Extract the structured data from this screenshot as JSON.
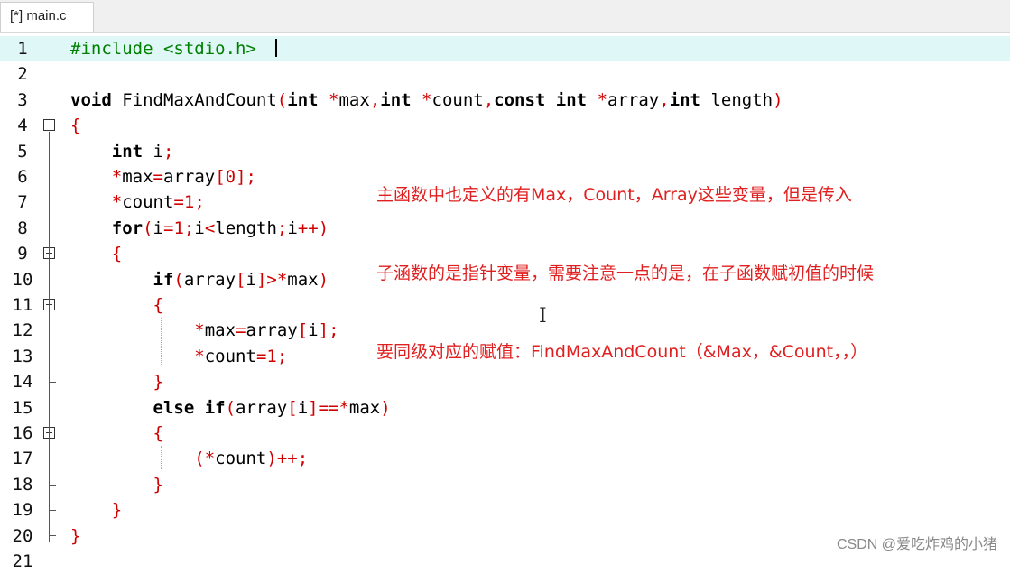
{
  "tab": {
    "title": "[*] main.c"
  },
  "lines": [
    {
      "n": "1",
      "segs": [
        [
          "pp",
          "#include <stdio.h>"
        ]
      ]
    },
    {
      "n": "2",
      "segs": []
    },
    {
      "n": "3",
      "segs": [
        [
          "kw",
          "void"
        ],
        [
          "t",
          " FindMaxAndCount"
        ],
        [
          "op",
          "("
        ],
        [
          "kw",
          "int"
        ],
        [
          "t",
          " "
        ],
        [
          "op",
          "*"
        ],
        [
          "t",
          "max"
        ],
        [
          "op",
          ","
        ],
        [
          "kw",
          "int"
        ],
        [
          "t",
          " "
        ],
        [
          "op",
          "*"
        ],
        [
          "t",
          "count"
        ],
        [
          "op",
          ","
        ],
        [
          "kw",
          "const int"
        ],
        [
          "t",
          " "
        ],
        [
          "op",
          "*"
        ],
        [
          "t",
          "array"
        ],
        [
          "op",
          ","
        ],
        [
          "kw",
          "int"
        ],
        [
          "t",
          " length"
        ],
        [
          "op",
          ")"
        ]
      ]
    },
    {
      "n": "4",
      "segs": [
        [
          "brace",
          "{"
        ]
      ]
    },
    {
      "n": "5",
      "segs": [
        [
          "t",
          "    "
        ],
        [
          "kw",
          "int"
        ],
        [
          "t",
          " i"
        ],
        [
          "op",
          ";"
        ]
      ]
    },
    {
      "n": "6",
      "segs": [
        [
          "t",
          "    "
        ],
        [
          "op",
          "*"
        ],
        [
          "t",
          "max"
        ],
        [
          "op",
          "="
        ],
        [
          "t",
          "array"
        ],
        [
          "op",
          "["
        ],
        [
          "num",
          "0"
        ],
        [
          "op",
          "];"
        ]
      ]
    },
    {
      "n": "7",
      "segs": [
        [
          "t",
          "    "
        ],
        [
          "op",
          "*"
        ],
        [
          "t",
          "count"
        ],
        [
          "op",
          "="
        ],
        [
          "num",
          "1"
        ],
        [
          "op",
          ";"
        ]
      ]
    },
    {
      "n": "8",
      "segs": [
        [
          "t",
          "    "
        ],
        [
          "kw",
          "for"
        ],
        [
          "op",
          "("
        ],
        [
          "t",
          "i"
        ],
        [
          "op",
          "="
        ],
        [
          "num",
          "1"
        ],
        [
          "op",
          ";"
        ],
        [
          "t",
          "i"
        ],
        [
          "op",
          "<"
        ],
        [
          "t",
          "length"
        ],
        [
          "op",
          ";"
        ],
        [
          "t",
          "i"
        ],
        [
          "op",
          "++)"
        ]
      ]
    },
    {
      "n": "9",
      "segs": [
        [
          "t",
          "    "
        ],
        [
          "brace",
          "{"
        ]
      ]
    },
    {
      "n": "10",
      "segs": [
        [
          "t",
          "        "
        ],
        [
          "kw",
          "if"
        ],
        [
          "op",
          "("
        ],
        [
          "t",
          "array"
        ],
        [
          "op",
          "["
        ],
        [
          "t",
          "i"
        ],
        [
          "op",
          "]>*"
        ],
        [
          "t",
          "max"
        ],
        [
          "op",
          ")"
        ]
      ]
    },
    {
      "n": "11",
      "segs": [
        [
          "t",
          "        "
        ],
        [
          "brace",
          "{"
        ]
      ]
    },
    {
      "n": "12",
      "segs": [
        [
          "t",
          "            "
        ],
        [
          "op",
          "*"
        ],
        [
          "t",
          "max"
        ],
        [
          "op",
          "="
        ],
        [
          "t",
          "array"
        ],
        [
          "op",
          "["
        ],
        [
          "t",
          "i"
        ],
        [
          "op",
          "];"
        ]
      ]
    },
    {
      "n": "13",
      "segs": [
        [
          "t",
          "            "
        ],
        [
          "op",
          "*"
        ],
        [
          "t",
          "count"
        ],
        [
          "op",
          "="
        ],
        [
          "num",
          "1"
        ],
        [
          "op",
          ";"
        ]
      ]
    },
    {
      "n": "14",
      "segs": [
        [
          "t",
          "        "
        ],
        [
          "brace",
          "}"
        ]
      ]
    },
    {
      "n": "15",
      "segs": [
        [
          "t",
          "        "
        ],
        [
          "kw",
          "else if"
        ],
        [
          "op",
          "("
        ],
        [
          "t",
          "array"
        ],
        [
          "op",
          "["
        ],
        [
          "t",
          "i"
        ],
        [
          "op",
          "]==*"
        ],
        [
          "t",
          "max"
        ],
        [
          "op",
          ")"
        ]
      ]
    },
    {
      "n": "16",
      "segs": [
        [
          "t",
          "        "
        ],
        [
          "brace",
          "{"
        ]
      ]
    },
    {
      "n": "17",
      "segs": [
        [
          "t",
          "            "
        ],
        [
          "op",
          "(*"
        ],
        [
          "t",
          "count"
        ],
        [
          "op",
          ")++;"
        ]
      ]
    },
    {
      "n": "18",
      "segs": [
        [
          "t",
          "        "
        ],
        [
          "brace",
          "}"
        ]
      ]
    },
    {
      "n": "19",
      "segs": [
        [
          "t",
          "    "
        ],
        [
          "brace",
          "}"
        ]
      ]
    },
    {
      "n": "20",
      "segs": [
        [
          "brace",
          "}"
        ]
      ]
    },
    {
      "n": "21",
      "segs": []
    }
  ],
  "annotation": {
    "line1": "主函数中也定义的有Max，Count，Array这些变量，但是传入",
    "line2": "子涵数的是指针变量，需要注意一点的是，在子函数赋初值的时候",
    "line3": "要同级对应的赋值：FindMaxAndCount（&Max，&Count，，）"
  },
  "watermark": "CSDN @爱吃炸鸡的小猪"
}
